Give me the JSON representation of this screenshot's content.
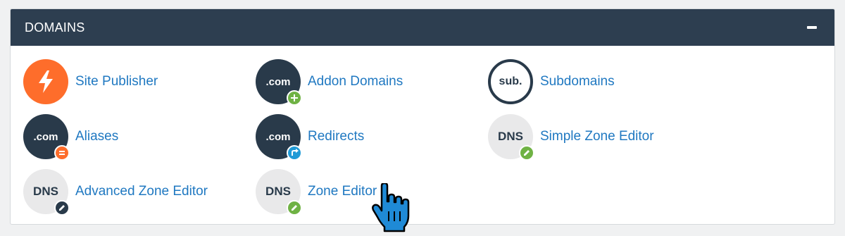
{
  "panel": {
    "title": "DOMAINS",
    "collapse_icon": "minus-icon"
  },
  "items": [
    {
      "label": "Site Publisher",
      "icon": "lightning-bolt-icon",
      "icon_text": ""
    },
    {
      "label": "Addon Domains",
      "icon": "dot-com-icon",
      "icon_text": ".com",
      "badge": "plus-badge-icon"
    },
    {
      "label": "Subdomains",
      "icon": "sub-icon",
      "icon_text": "sub."
    },
    {
      "label": "Aliases",
      "icon": "dot-com-icon",
      "icon_text": ".com",
      "badge": "equals-badge-icon"
    },
    {
      "label": "Redirects",
      "icon": "dot-com-icon",
      "icon_text": ".com",
      "badge": "redirect-badge-icon"
    },
    {
      "label": "Simple Zone Editor",
      "icon": "dns-icon",
      "icon_text": "DNS",
      "badge": "pencil-badge-icon"
    },
    {
      "label": "Advanced Zone Editor",
      "icon": "dns-icon",
      "icon_text": "DNS",
      "badge": "pencil-badge-icon"
    },
    {
      "label": "Zone Editor",
      "icon": "dns-icon",
      "icon_text": "DNS",
      "badge": "pencil-badge-icon"
    }
  ],
  "colors": {
    "header_bg": "#2d3e50",
    "link": "#1f78c1",
    "orange": "#fe6d2b",
    "green": "#6fb244",
    "blue": "#1f9ad6",
    "dark": "#293a4a"
  },
  "cursor": "pointer-hand-cursor-icon"
}
